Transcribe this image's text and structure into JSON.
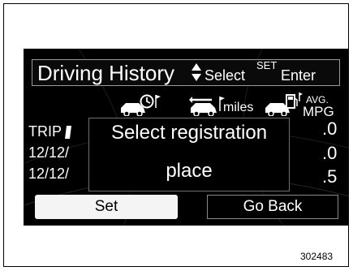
{
  "header": {
    "title": "Driving History",
    "select_label": "Select",
    "set_tag": "SET",
    "enter_label": "Enter"
  },
  "columns": {
    "col1_icon": "car-clock-flag-icon",
    "col2_icon": "car-arrow-flag-icon",
    "col2_label": "miles",
    "col3_icon": "car-fuel-pump-icon",
    "col3_label_top": "AVG.",
    "col3_label_bottom": "MPG"
  },
  "rows": [
    {
      "label": "TRIP",
      "value": ".0"
    },
    {
      "label": "12/12/",
      "value": ".0"
    },
    {
      "label": "12/12/",
      "value": ".5"
    }
  ],
  "dialog": {
    "line1": "Select registration",
    "line2": "place"
  },
  "buttons": {
    "set": "Set",
    "go_back": "Go Back"
  },
  "figure_id": "302483",
  "colors": {
    "screen_bg": "#000000",
    "text": "#ffffff",
    "selected_button_bg": "#f4f4f4"
  }
}
